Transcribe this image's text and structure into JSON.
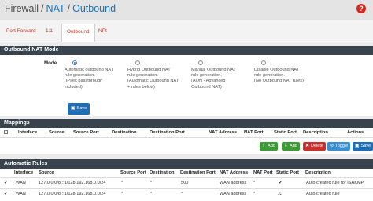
{
  "breadcrumb": {
    "root": "Firewall",
    "sep": "/",
    "level1": "NAT",
    "level2": "Outbound"
  },
  "help_label": "?",
  "tabs": [
    {
      "label": "Port Forward"
    },
    {
      "label": "1:1"
    },
    {
      "label": "Outbound"
    },
    {
      "label": "NPt"
    }
  ],
  "mode_panel": {
    "title": "Outbound NAT Mode",
    "mode_label": "Mode",
    "options": [
      {
        "text": "Automatic outbound NAT\nrule generation.\n(IPsec passthrough\nincluded)",
        "selected": true
      },
      {
        "text": "Hybrid Outbound NAT\nrule generation.\n(Automatic Outbound NAT\n+ rules below)",
        "selected": false
      },
      {
        "text": "Manual Outbound NAT\nrule generation.\n(AON - Advanced\nOutbound NAT)",
        "selected": false
      },
      {
        "text": "Disable Outbound NAT\nrule generation.\n(No Outbound NAT rules)",
        "selected": false
      }
    ],
    "save_label": "Save"
  },
  "mappings": {
    "title": "Mappings",
    "columns": [
      "Interface",
      "Source",
      "Source Port",
      "Destination",
      "Destination Port",
      "NAT Address",
      "NAT Port",
      "Static Port",
      "Description",
      "Actions"
    ],
    "buttons": {
      "add_top": "Add",
      "add_bottom": "Add",
      "delete": "Delete",
      "toggle": "Toggle",
      "save": "Save"
    }
  },
  "auto_rules": {
    "title": "Automatic Rules",
    "columns": [
      "Interface",
      "Source",
      "Source Port",
      "Destination",
      "Destination Port",
      "NAT Address",
      "NAT Port",
      "Static Port",
      "Description"
    ],
    "rows": [
      {
        "interface": "WAN",
        "source": "127.0.0.0/8 ::1/128 192.168.0.0/24",
        "source_port": "*",
        "destination": "*",
        "destination_port": "500",
        "nat_address": "WAN address",
        "nat_port": "*",
        "static_port": "check",
        "description": "Auto created rule for ISAKMP"
      },
      {
        "interface": "WAN",
        "source": "127.0.0.0/8 ::1/128 192.168.0.0/24",
        "source_port": "*",
        "destination": "*",
        "destination_port": "*",
        "nat_address": "WAN address",
        "nat_port": "*",
        "static_port": "shuffle",
        "description": "Auto created rule"
      }
    ]
  }
}
